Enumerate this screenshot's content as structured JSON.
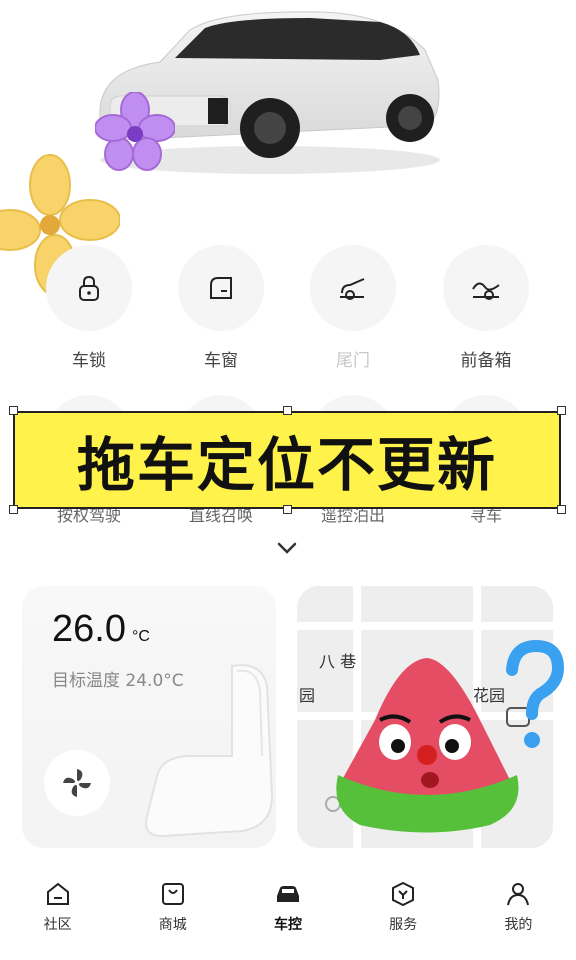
{
  "controls": {
    "row1": [
      {
        "label": "车锁",
        "icon": "lock-icon",
        "dim": false
      },
      {
        "label": "车窗",
        "icon": "window-icon",
        "dim": false
      },
      {
        "label": "尾门",
        "icon": "tailgate-icon",
        "dim": true
      },
      {
        "label": "前备箱",
        "icon": "frunk-icon",
        "dim": false
      }
    ],
    "row2": [
      "按权驾驶",
      "直线召唤",
      "遥控泊出",
      "寻车"
    ]
  },
  "banner": {
    "text": "拖车定位不更新"
  },
  "climate": {
    "temperature": "26.0",
    "unit": "°C",
    "target_text": "目标温度 24.0°C"
  },
  "map": {
    "labels": [
      "八 巷",
      "园",
      "花园"
    ]
  },
  "tabbar": {
    "items": [
      {
        "label": "社区",
        "icon": "community-icon",
        "active": false
      },
      {
        "label": "商城",
        "icon": "shop-icon",
        "active": false
      },
      {
        "label": "车控",
        "icon": "car-control-icon",
        "active": true
      },
      {
        "label": "服务",
        "icon": "service-icon",
        "active": false
      },
      {
        "label": "我的",
        "icon": "profile-icon",
        "active": false
      }
    ]
  },
  "colors": {
    "banner": "#fff24a",
    "accent": "#111111"
  }
}
